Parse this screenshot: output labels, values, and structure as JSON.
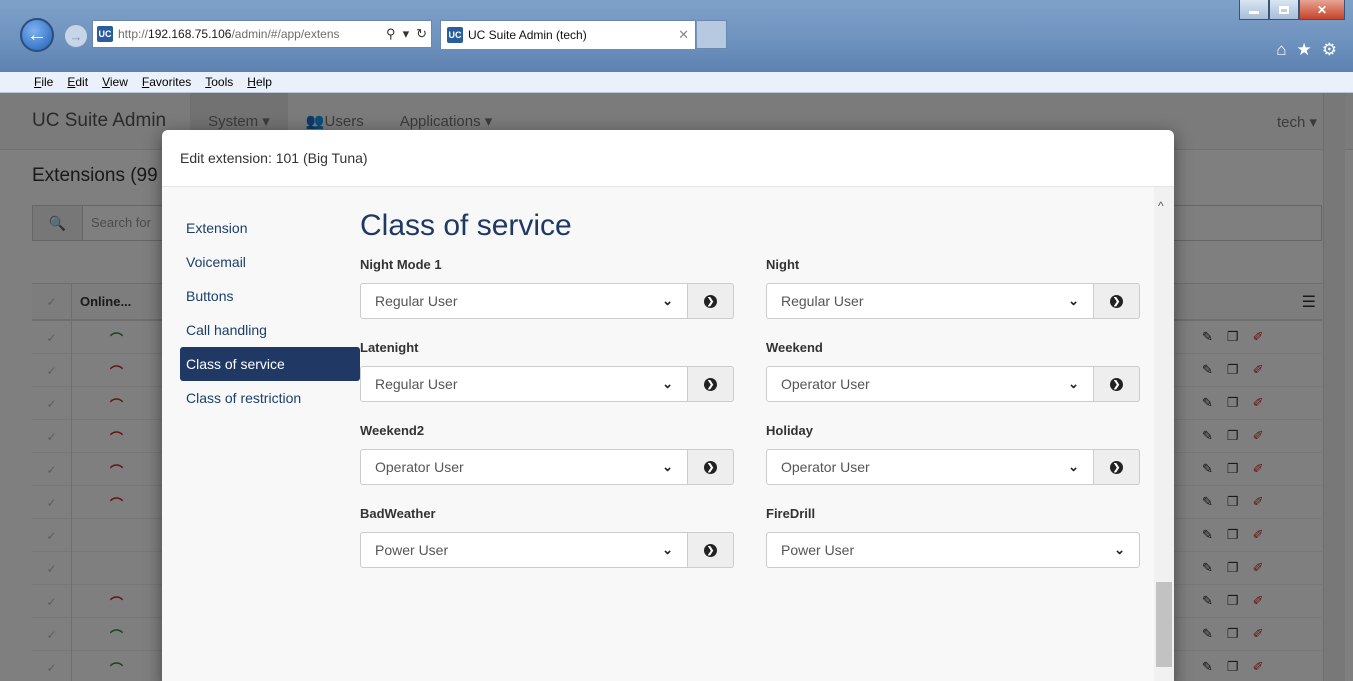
{
  "browser": {
    "address_host": "192.168.75.106",
    "address_prefix": "http://",
    "address_rest": "/admin/#/app/extens",
    "tab_title": "UC Suite Admin (tech)",
    "menu": [
      "File",
      "Edit",
      "View",
      "Favorites",
      "Tools",
      "Help"
    ]
  },
  "app": {
    "brand": "UC Suite Admin",
    "nav_system": "System ▾",
    "nav_users": "Users",
    "nav_applications": "Applications ▾",
    "user": "tech ▾",
    "page_title": "Extensions (99",
    "search_placeholder": "Search for",
    "grid_col_online": "Online...",
    "rows": [
      {
        "color": "#2e8b3d"
      },
      {
        "color": "#c62828"
      },
      {
        "color": "#c62828"
      },
      {
        "color": "#c62828"
      },
      {
        "color": "#c62828"
      },
      {
        "color": "#c62828"
      },
      {
        "color": ""
      },
      {
        "color": ""
      },
      {
        "color": "#c62828"
      },
      {
        "color": "#2e8b3d"
      },
      {
        "color": "#2e8b3d"
      }
    ]
  },
  "modal": {
    "title": "Edit extension: 101 (Big Tuna)",
    "section_title": "Class of service",
    "nav": [
      {
        "label": "Extension",
        "active": false
      },
      {
        "label": "Voicemail",
        "active": false
      },
      {
        "label": "Buttons",
        "active": false
      },
      {
        "label": "Call handling",
        "active": false
      },
      {
        "label": "Class of service",
        "active": true
      },
      {
        "label": "Class of restriction",
        "active": false
      }
    ],
    "fields": [
      {
        "label": "Night Mode 1",
        "value": "Regular User",
        "has_go": true
      },
      {
        "label": "Night",
        "value": "Regular User",
        "has_go": true
      },
      {
        "label": "Latenight",
        "value": "Regular User",
        "has_go": true
      },
      {
        "label": "Weekend",
        "value": "Operator User",
        "has_go": true
      },
      {
        "label": "Weekend2",
        "value": "Operator User",
        "has_go": true
      },
      {
        "label": "Holiday",
        "value": "Operator User",
        "has_go": true
      },
      {
        "label": "BadWeather",
        "value": "Power User",
        "has_go": true
      },
      {
        "label": "FireDrill",
        "value": "Power User",
        "has_go": false
      }
    ]
  },
  "colors": {
    "accent": "#1f3864",
    "online_green": "#2e8b3d",
    "offline_red": "#c62828"
  }
}
